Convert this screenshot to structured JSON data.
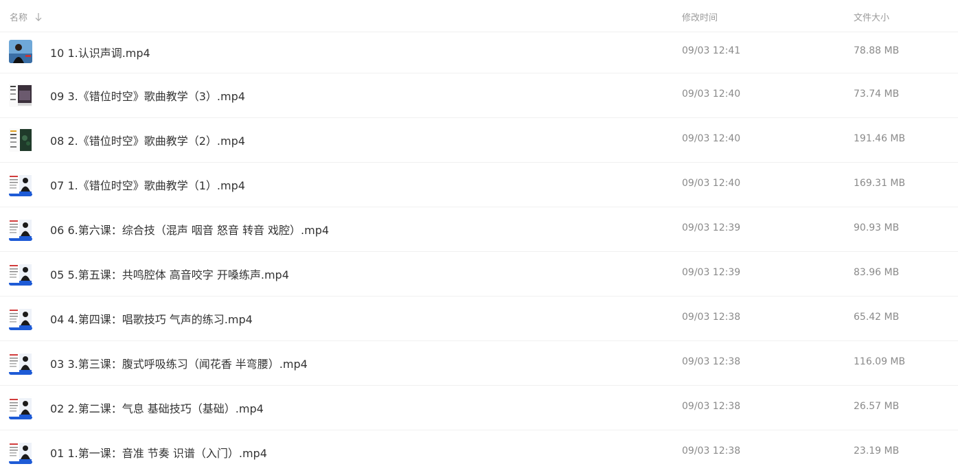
{
  "header": {
    "name_label": "名称",
    "time_label": "修改时间",
    "size_label": "文件大小",
    "sort_icon": "arrow-down-icon"
  },
  "files": [
    {
      "name": "10 1.认识声调.mp4",
      "time": "09/03 12:41",
      "size": "78.88 MB",
      "thumb": "photo"
    },
    {
      "name": "09 3.《错位时空》歌曲教学（3）.mp4",
      "time": "09/03 12:40",
      "size": "73.74 MB",
      "thumb": "dark"
    },
    {
      "name": "08 2.《错位时空》歌曲教学（2）.mp4",
      "time": "09/03 12:40",
      "size": "191.46 MB",
      "thumb": "green"
    },
    {
      "name": "07 1.《错位时空》歌曲教学（1）.mp4",
      "time": "09/03 12:40",
      "size": "169.31 MB",
      "thumb": "blue"
    },
    {
      "name": "06 6.第六课：综合技（混声 咽音 怒音 转音 戏腔）.mp4",
      "time": "09/03 12:39",
      "size": "90.93 MB",
      "thumb": "blue"
    },
    {
      "name": "05 5.第五课：共鸣腔体 高音咬字 开嗓练声.mp4",
      "time": "09/03 12:39",
      "size": "83.96 MB",
      "thumb": "blue"
    },
    {
      "name": "04 4.第四课：唱歌技巧 气声的练习.mp4",
      "time": "09/03 12:38",
      "size": "65.42 MB",
      "thumb": "blue"
    },
    {
      "name": "03 3.第三课：腹式呼吸练习（闻花香 半弯腰）.mp4",
      "time": "09/03 12:38",
      "size": "116.09 MB",
      "thumb": "blue"
    },
    {
      "name": "02 2.第二课：气息 基础技巧（基础）.mp4",
      "time": "09/03 12:38",
      "size": "26.57 MB",
      "thumb": "blue"
    },
    {
      "name": "01 1.第一课：音准 节奏 识谱（入门）.mp4",
      "time": "09/03 12:38",
      "size": "23.19 MB",
      "thumb": "blue"
    }
  ]
}
